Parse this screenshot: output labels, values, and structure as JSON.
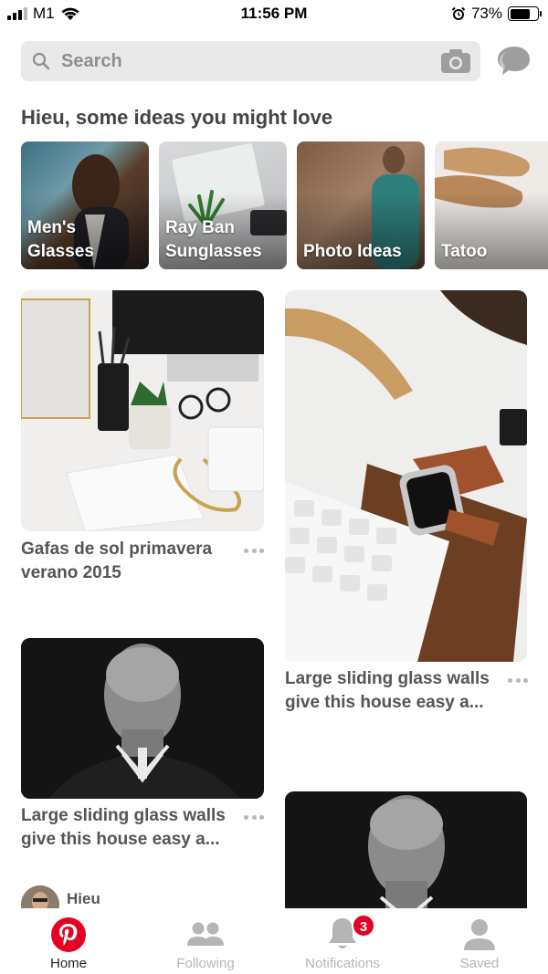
{
  "status_bar": {
    "carrier": "M1",
    "time": "11:56 PM",
    "battery_percent": "73%",
    "battery_level": 0.73
  },
  "search": {
    "placeholder": "Search"
  },
  "ideas": {
    "heading": "Hieu, some ideas you might love",
    "cards": [
      {
        "label": "Men's Glasses"
      },
      {
        "label": "Ray Ban Sunglasses"
      },
      {
        "label": "Photo Ideas"
      },
      {
        "label": "Tatoo"
      }
    ]
  },
  "pins": [
    {
      "title": "Gafas de sol primavera verano 2015"
    },
    {
      "title": "Large sliding glass walls give this house easy a..."
    },
    {
      "title": "Large sliding glass walls give this house easy a..."
    }
  ],
  "pinner": {
    "name": "Hieu"
  },
  "tabs": [
    {
      "label": "Home"
    },
    {
      "label": "Following"
    },
    {
      "label": "Notifications",
      "badge": "3"
    },
    {
      "label": "Saved"
    }
  ],
  "colors": {
    "brand_red": "#e60023",
    "inactive_tab": "#b5b5b5"
  }
}
